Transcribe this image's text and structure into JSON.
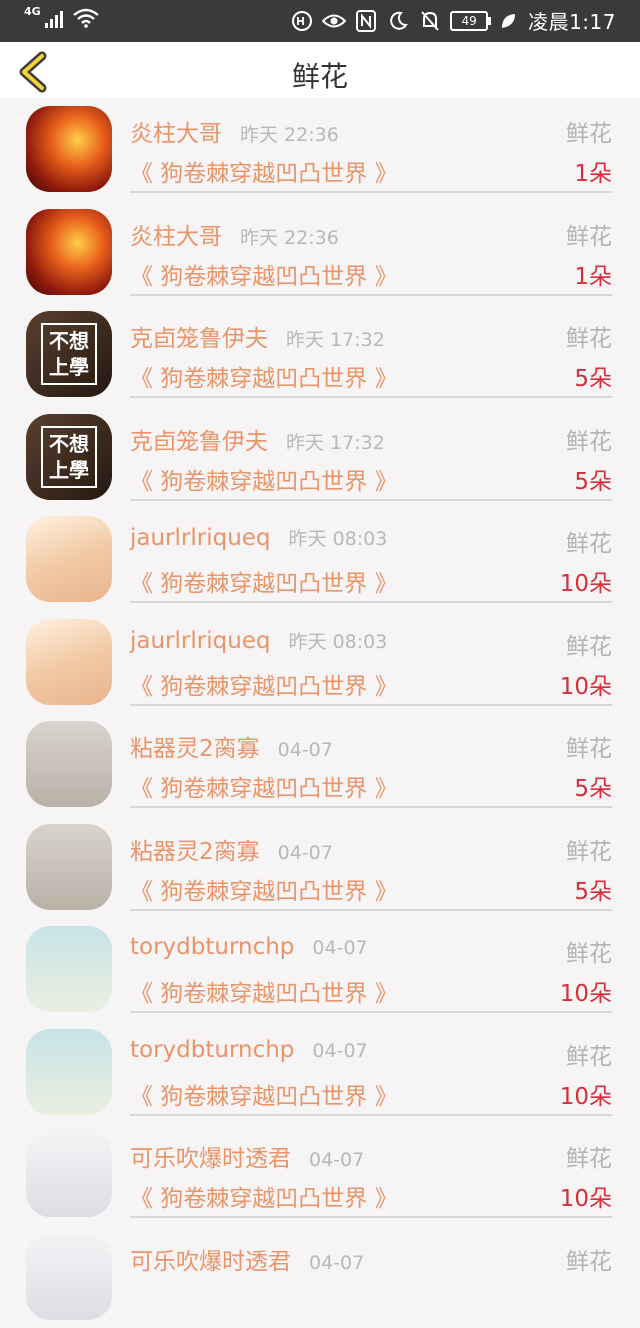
{
  "status_bar": {
    "network": "4G",
    "battery": "49",
    "time": "凌晨1:17"
  },
  "header": {
    "title": "鲜花"
  },
  "rows": [
    {
      "avatar": "fire",
      "name": "炎柱大哥",
      "time": "昨天 22:36",
      "kind": "鲜花",
      "book": "《 狗卷棘穿越凹凸世界 》",
      "count": "1朵"
    },
    {
      "avatar": "fire",
      "name": "炎柱大哥",
      "time": "昨天 22:36",
      "kind": "鲜花",
      "book": "《 狗卷棘穿越凹凸世界 》",
      "count": "1朵"
    },
    {
      "avatar": "txt",
      "avatar_text_1": "不想",
      "avatar_text_2": "上學",
      "name": "克卣笼鲁伊夫",
      "time": "昨天 17:32",
      "kind": "鲜花",
      "book": "《 狗卷棘穿越凹凸世界 》",
      "count": "5朵"
    },
    {
      "avatar": "txt",
      "avatar_text_1": "不想",
      "avatar_text_2": "上學",
      "name": "克卣笼鲁伊夫",
      "time": "昨天 17:32",
      "kind": "鲜花",
      "book": "《 狗卷棘穿越凹凸世界 》",
      "count": "5朵"
    },
    {
      "avatar": "crane",
      "name": "jaurlrlriqueq",
      "time": "昨天 08:03",
      "kind": "鲜花",
      "book": "《 狗卷棘穿越凹凸世界 》",
      "count": "10朵"
    },
    {
      "avatar": "crane",
      "name": "jaurlrlriqueq",
      "time": "昨天 08:03",
      "kind": "鲜花",
      "book": "《 狗卷棘穿越凹凸世界 》",
      "count": "10朵"
    },
    {
      "avatar": "danbo",
      "name": "粘器灵2脔寡",
      "time": "04-07",
      "kind": "鲜花",
      "book": "《 狗卷棘穿越凹凸世界 》",
      "count": "5朵"
    },
    {
      "avatar": "danbo",
      "name": "粘器灵2脔寡",
      "time": "04-07",
      "kind": "鲜花",
      "book": "《 狗卷棘穿越凹凸世界 》",
      "count": "5朵"
    },
    {
      "avatar": "wreath",
      "name": "torydbturnchp",
      "time": "04-07",
      "kind": "鲜花",
      "book": "《 狗卷棘穿越凹凸世界 》",
      "count": "10朵"
    },
    {
      "avatar": "wreath",
      "name": "torydbturnchp",
      "time": "04-07",
      "kind": "鲜花",
      "book": "《 狗卷棘穿越凹凸世界 》",
      "count": "10朵"
    },
    {
      "avatar": "anime",
      "name": "可乐吹爆时透君",
      "time": "04-07",
      "kind": "鲜花",
      "book": "《 狗卷棘穿越凹凸世界 》",
      "count": "10朵"
    },
    {
      "avatar": "anime",
      "name": "可乐吹爆时透君",
      "time": "04-07",
      "kind": "鲜花",
      "book": "",
      "count": ""
    }
  ]
}
